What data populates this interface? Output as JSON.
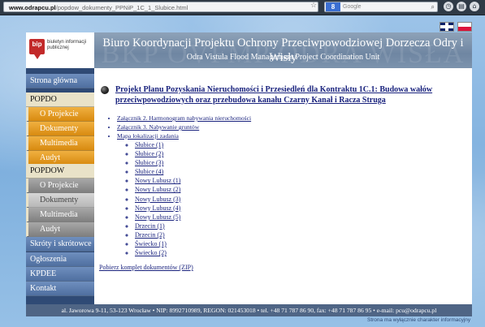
{
  "browser": {
    "url_host": "www.odrapcu.pl",
    "url_path": "/popdow_dokumenty_PPNiP_1C_1_Slubice.html",
    "search_placeholder": "Google",
    "search_engine_badge": "8"
  },
  "languages": [
    "en",
    "pl"
  ],
  "logo": {
    "mark": "bip",
    "text": "biuletyn informacji publicznej"
  },
  "header": {
    "title": "Biuro Koordynacji Projektu Ochrony Przeciwpowodziowej Dorzecza Odry i Wisły",
    "subtitle": "Odra Vistula Flood Management Project Coordination Unit",
    "watermark": "BKP OVFMP ODRA WISŁA"
  },
  "sidebar": {
    "items": [
      {
        "label": "Strona główna",
        "style": "blue"
      },
      {
        "label": "POPDO",
        "style": "section"
      },
      {
        "label": "O Projekcie",
        "style": "orange"
      },
      {
        "label": "Dokumenty",
        "style": "orange"
      },
      {
        "label": "Multimedia",
        "style": "orange"
      },
      {
        "label": "Audyt",
        "style": "orange"
      },
      {
        "label": "POPDOW",
        "style": "section"
      },
      {
        "label": "O Projekcie",
        "style": "grey"
      },
      {
        "label": "Dokumenty",
        "style": "grey-active"
      },
      {
        "label": "Multimedia",
        "style": "grey"
      },
      {
        "label": "Audyt",
        "style": "grey"
      },
      {
        "label": "Skróty i skrótowce",
        "style": "blue"
      },
      {
        "label": "Ogłoszenia",
        "style": "blue"
      },
      {
        "label": "KPDEE",
        "style": "blue"
      },
      {
        "label": "Kontakt",
        "style": "blue"
      }
    ]
  },
  "content": {
    "project_title": "Projekt Planu Pozyskania Nieruchomości i Przesiedleń dla Kontraktu 1C.1: Budowa wałów przeciwpowodziowych oraz przebudowa kanału Czarny Kanał i Racza Struga",
    "links": [
      "Załącznik 2. Harmonogram nabywania nieruchomości",
      "Załącznik 3. Nabywanie gruntów",
      "Mapa lokalizacji zadania"
    ],
    "map_links": [
      "Słubice (1)",
      "Słubice (2)",
      "Słubice (3)",
      "Słubice (4)",
      "Nowy Lubusz (1)",
      "Nowy Lubusz (2)",
      "Nowy Lubusz (3)",
      "Nowy Lubusz (4)",
      "Nowy Lubusz (5)",
      "Drzecin (1)",
      "Drzecin (2)",
      "Świecko (1)",
      "Świecko (2)"
    ],
    "zip_link": "Pobierz komplet dokumentów (ZIP)"
  },
  "footer": {
    "text": "al. Jaworowa 9-11, 53-123 Wrocław • NIP: 8992710989, REGON: 021453018 • tel. +48 71 787 86 90, fax: +48 71 787 86 95 • e-mail: pcu@odrapcu.pl",
    "note": "Strona ma wyłącznie charakter informacyjny"
  },
  "colors": {
    "sidebar_blue": "#4f6fa0",
    "orange": "#d88a10",
    "grey": "#808080",
    "link": "#1a237e",
    "footer": "#4f6585"
  }
}
